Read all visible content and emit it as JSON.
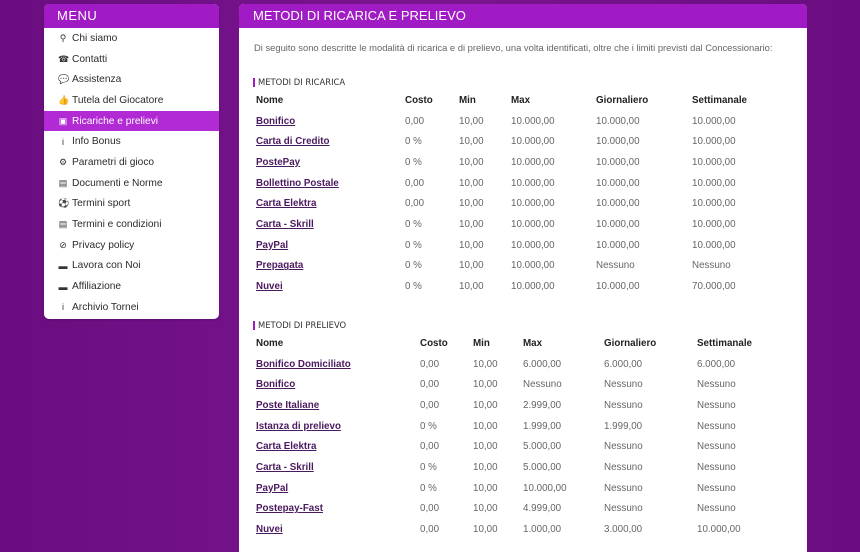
{
  "sidebar": {
    "title": "MENU",
    "items": [
      {
        "label": "Chi siamo",
        "icon": "map-pin-icon",
        "glyph": "⚲"
      },
      {
        "label": "Contatti",
        "icon": "phone-icon",
        "glyph": "☎"
      },
      {
        "label": "Assistenza",
        "icon": "chat-icon",
        "glyph": "💬"
      },
      {
        "label": "Tutela del Giocatore",
        "icon": "thumbs-up-icon",
        "glyph": "👍"
      },
      {
        "label": "Ricariche e prelievi",
        "icon": "money-icon",
        "glyph": "▣"
      },
      {
        "label": "Info Bonus",
        "icon": "info-icon",
        "glyph": "i"
      },
      {
        "label": "Parametri di gioco",
        "icon": "gears-icon",
        "glyph": "⚙"
      },
      {
        "label": "Documenti e Norme",
        "icon": "document-icon",
        "glyph": "▤"
      },
      {
        "label": "Termini sport",
        "icon": "soccer-ball-icon",
        "glyph": "⚽"
      },
      {
        "label": "Termini e condizioni",
        "icon": "file-icon",
        "glyph": "▤"
      },
      {
        "label": "Privacy policy",
        "icon": "ban-icon",
        "glyph": "⊘"
      },
      {
        "label": "Lavora con Noi",
        "icon": "briefcase-icon",
        "glyph": "▬"
      },
      {
        "label": "Affiliazione",
        "icon": "briefcase-icon",
        "glyph": "▬"
      },
      {
        "label": "Archivio Tornei",
        "icon": "info-icon",
        "glyph": "i"
      }
    ],
    "active_index": 4
  },
  "main": {
    "title": "METODI DI RICARICA E PRELIEVO",
    "intro": "Di seguito sono descritte le modalità di ricarica e di prelievo, una volta identificati, oltre che i limiti previsti dal Concessionario:",
    "ricarica": {
      "title": "METODI DI RICARICA",
      "headers": [
        "Nome",
        "Costo",
        "Min",
        "Max",
        "Giornaliero",
        "Settimanale"
      ],
      "rows": [
        [
          "Bonifico",
          "0,00",
          "10,00",
          "10.000,00",
          "10.000,00",
          "10.000,00"
        ],
        [
          "Carta di Credito",
          "0 %",
          "10,00",
          "10.000,00",
          "10.000,00",
          "10.000,00"
        ],
        [
          "PostePay",
          "0 %",
          "10,00",
          "10.000,00",
          "10.000,00",
          "10.000,00"
        ],
        [
          "Bollettino Postale",
          "0,00",
          "10,00",
          "10.000,00",
          "10.000,00",
          "10.000,00"
        ],
        [
          "Carta Elektra",
          "0,00",
          "10,00",
          "10.000,00",
          "10.000,00",
          "10.000,00"
        ],
        [
          "Carta - Skrill",
          "0 %",
          "10,00",
          "10.000,00",
          "10.000,00",
          "10.000,00"
        ],
        [
          "PayPal",
          "0 %",
          "10,00",
          "10.000,00",
          "10.000,00",
          "10.000,00"
        ],
        [
          "Prepagata",
          "0 %",
          "10,00",
          "10.000,00",
          "Nessuno",
          "Nessuno"
        ],
        [
          "Nuvei",
          "0 %",
          "10,00",
          "10.000,00",
          "10.000,00",
          "70.000,00"
        ]
      ]
    },
    "prelievo": {
      "title": "METODI DI PRELIEVO",
      "headers": [
        "Nome",
        "Costo",
        "Min",
        "Max",
        "Giornaliero",
        "Settimanale"
      ],
      "rows": [
        [
          "Bonifico Domiciliato",
          "0,00",
          "10,00",
          "6.000,00",
          "6.000,00",
          "6.000,00"
        ],
        [
          "Bonifico",
          "0,00",
          "10,00",
          "Nessuno",
          "Nessuno",
          "Nessuno"
        ],
        [
          "Poste Italiane",
          "0,00",
          "10,00",
          "2.999,00",
          "Nessuno",
          "Nessuno"
        ],
        [
          "Istanza di prelievo",
          "0 %",
          "10,00",
          "1.999,00",
          "1.999,00",
          "Nessuno"
        ],
        [
          "Carta Elektra",
          "0,00",
          "10,00",
          "5.000,00",
          "Nessuno",
          "Nessuno"
        ],
        [
          "Carta - Skrill",
          "0 %",
          "10,00",
          "5.000,00",
          "Nessuno",
          "Nessuno"
        ],
        [
          "PayPal",
          "0 %",
          "10,00",
          "10.000,00",
          "Nessuno",
          "Nessuno"
        ],
        [
          "Postepay-Fast",
          "0,00",
          "10,00",
          "4.999,00",
          "Nessuno",
          "Nessuno"
        ],
        [
          "Nuvei",
          "0,00",
          "10,00",
          "1.000,00",
          "3.000,00",
          "10.000,00"
        ]
      ]
    }
  },
  "colors": {
    "accent": "#a11bc4",
    "active": "#b12ad3",
    "background": "#6a0d80",
    "link": "#4a1a5e"
  }
}
